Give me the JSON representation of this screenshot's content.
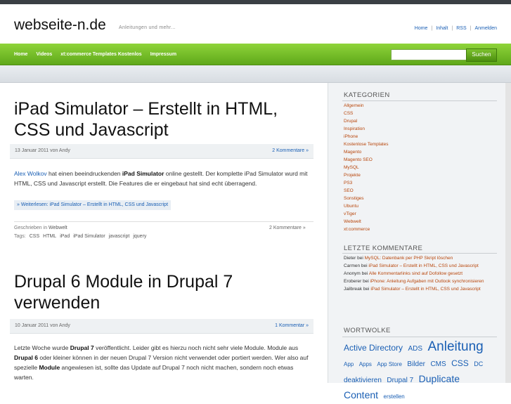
{
  "site": {
    "logo": "webseite-n.de",
    "tagline": "Anleitungen und mehr..."
  },
  "toplinks": [
    "Home",
    "Inhalt",
    "RSS",
    "Anmelden"
  ],
  "nav": [
    "Home",
    "Videos",
    "xt:commerce Templates Kostenlos",
    "Impressum"
  ],
  "search": {
    "placeholder": "",
    "button": "Suchen"
  },
  "posts": [
    {
      "title": "iPad Simulator – Erstellt in HTML, CSS und Javascript",
      "date": "13 Januar 2011 von Andy",
      "comments": "2 Kommentare »",
      "excerpt": {
        "link": "Alex Wolkov",
        "t1": " hat einen beeindruckenden ",
        "b1": "iPad Simulator",
        "t2": " online gestellt. Der komplette iPad Simulator wurd mit HTML, CSS und Javascript erstellt. Die Features die er eingebaut hat sind echt überragend."
      },
      "readmore": "» Weiterlesen: iPad Simulator – Erstellt in HTML, CSS und Javascript",
      "category_prefix": "Geschrieben in ",
      "category": "Webwelt",
      "footer_comments": "2 Kommentare »",
      "tags_label": "Tags:",
      "tags": [
        "CSS",
        "HTML",
        "iPad",
        "iPad Simulator",
        "javascript",
        "jquery"
      ]
    },
    {
      "title": "Drupal 6 Module in Drupal 7 verwenden",
      "date": "10 Januar 2011 von Andy",
      "comments": "1 Kommentar »",
      "excerpt": {
        "t1": "Letzte Woche wurde ",
        "b1": "Drupal 7",
        "t2": " veröffentlicht. Leider gibt es hierzu noch nicht sehr viele Module. Module aus ",
        "b2": "Drupal 6",
        "t3": " oder kleiner können in der neuen Drupal 7 Version nicht verwendet oder portiert werden. Wer also auf spezielle ",
        "b3": "Module",
        "t4": " angewiesen ist, sollte das Update auf Drupal 7 noch nicht machen, sondern noch etwas warten."
      }
    }
  ],
  "sidebar": {
    "categories_title": "KATEGORIEN",
    "categories": [
      "Allgemein",
      "CSS",
      "Drupal",
      "Inspiration",
      "iPhone",
      "Kostenlose Templates",
      "Magento",
      "Magento SEO",
      "MySQL",
      "Projekte",
      "PS3",
      "SEO",
      "Sonstiges",
      "Ubuntu",
      "vTiger",
      "Webwelt",
      "xt:commerce"
    ],
    "comments_title": "LETZTE KOMMENTARE",
    "comments": [
      {
        "author": "Dieter",
        "on": " bei ",
        "post": "MySQL: Datenbank per PHP Skript löschen"
      },
      {
        "author": "Carmen",
        "on": " bei ",
        "post": "iPad Simulator – Erstellt in HTML, CSS und Javascript"
      },
      {
        "author": "Anonym",
        "on": " bei ",
        "post": "Alle Kommentarlinks sind auf Dofollow gesetzt"
      },
      {
        "author": "Eroberer",
        "on": " bei ",
        "post": "iPhone: Anleitung Aufgaben mit Outlook synchronisieren"
      },
      {
        "author": "Jailbreak",
        "on": " bei ",
        "post": "iPad Simulator – Erstellt in HTML, CSS und Javascript"
      }
    ],
    "tagcloud_title": "WORTWOLKE",
    "tagcloud": [
      {
        "text": "Active Directory",
        "size": 12
      },
      {
        "text": "ADS",
        "size": 10
      },
      {
        "text": "Anleitung",
        "size": 19
      },
      {
        "text": "App",
        "size": 8
      },
      {
        "text": "Apps",
        "size": 8
      },
      {
        "text": "App Store",
        "size": 8
      },
      {
        "text": "Bilder",
        "size": 10
      },
      {
        "text": "CMS",
        "size": 10
      },
      {
        "text": "CSS",
        "size": 12
      },
      {
        "text": "DC",
        "size": 9
      },
      {
        "text": "deaktivieren",
        "size": 10
      },
      {
        "text": "Drupal 7",
        "size": 10
      },
      {
        "text": "Duplicate Content",
        "size": 14
      },
      {
        "text": "erstellen",
        "size": 8
      }
    ]
  },
  "colors": {
    "accent": "#6cbf22",
    "link": "#1a5fb4",
    "category": "#b8460b"
  }
}
